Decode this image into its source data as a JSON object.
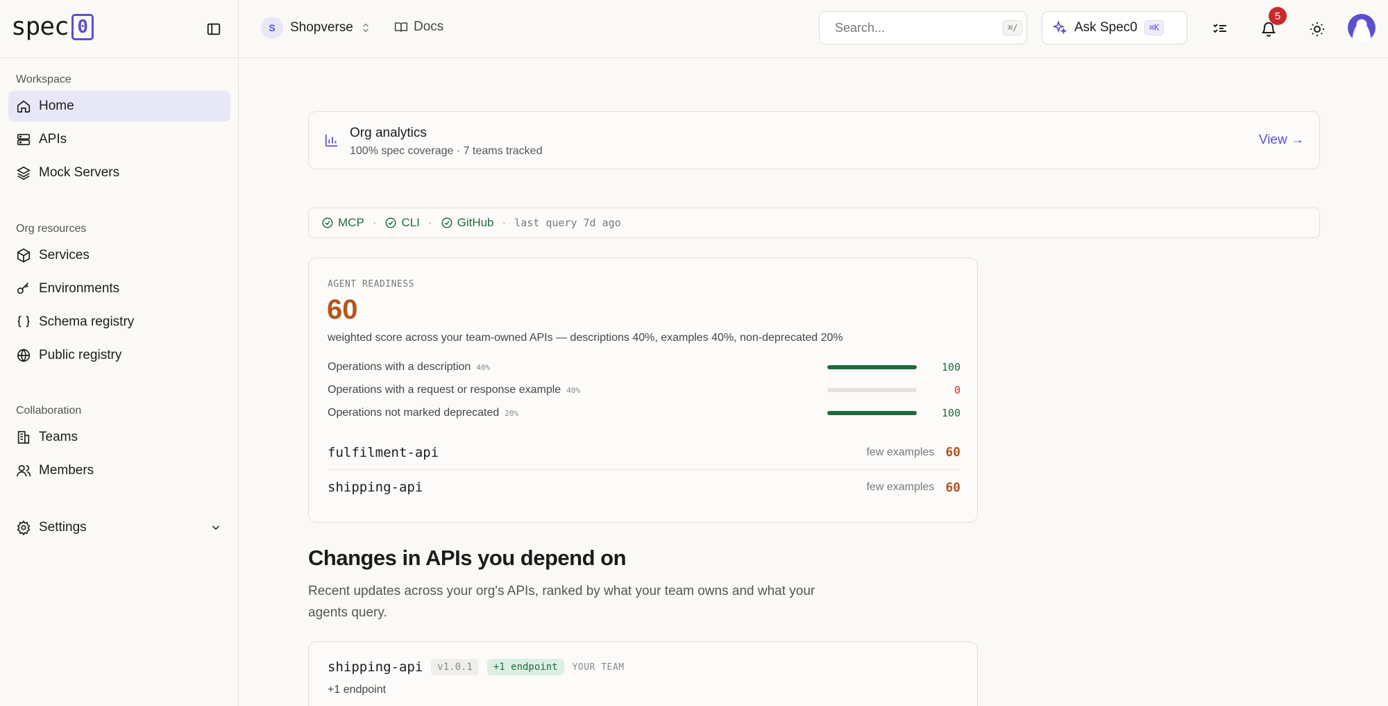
{
  "brand": {
    "text": "spec",
    "mark": "0"
  },
  "org": {
    "initial": "S",
    "name": "Shopverse"
  },
  "docs_label": "Docs",
  "search": {
    "placeholder": "Search...",
    "shortcut": "⌘/"
  },
  "ask": {
    "label": "Ask Spec0",
    "shortcut": "⌘K"
  },
  "notifications": {
    "count": "5"
  },
  "sidebar": {
    "workspace_heading": "Workspace",
    "workspace_items": [
      {
        "label": "Home",
        "icon": "home-icon",
        "active": true
      },
      {
        "label": "APIs",
        "icon": "server-icon"
      },
      {
        "label": "Mock Servers",
        "icon": "layers-icon"
      }
    ],
    "resources_heading": "Org resources",
    "resources_items": [
      {
        "label": "Services",
        "icon": "box-icon"
      },
      {
        "label": "Environments",
        "icon": "key-icon"
      },
      {
        "label": "Schema registry",
        "icon": "braces-icon"
      },
      {
        "label": "Public registry",
        "icon": "globe-icon"
      }
    ],
    "collab_heading": "Collaboration",
    "collab_items": [
      {
        "label": "Teams",
        "icon": "building-icon"
      },
      {
        "label": "Members",
        "icon": "users-icon"
      }
    ],
    "settings_label": "Settings"
  },
  "analytics": {
    "title": "Org analytics",
    "subtitle": "100% spec coverage · 7 teams tracked",
    "view_label": "View →"
  },
  "integrations": {
    "items": [
      "MCP",
      "CLI",
      "GitHub"
    ],
    "last_query": "last query 7d ago",
    "status_color": "#1f6b3d"
  },
  "readiness": {
    "eyebrow": "AGENT READINESS",
    "score": "60",
    "description": "weighted score across your team-owned APIs — descriptions 40%, examples 40%, non-deprecated 20%",
    "metrics": [
      {
        "label": "Operations with a description",
        "weight": "40%",
        "value": "100",
        "fill": 1.0
      },
      {
        "label": "Operations with a request or response example",
        "weight": "40%",
        "value": "0",
        "fill": 0.0
      },
      {
        "label": "Operations not marked deprecated",
        "weight": "20%",
        "value": "100",
        "fill": 1.0
      }
    ],
    "apis": [
      {
        "name": "fulfilment-api",
        "note": "few examples",
        "score": "60"
      },
      {
        "name": "shipping-api",
        "note": "few examples",
        "score": "60"
      }
    ]
  },
  "changes": {
    "title": "Changes in APIs you depend on",
    "description": "Recent updates across your org's APIs, ranked by what your team owns and what your agents query.",
    "items": [
      {
        "name": "shipping-api",
        "version": "v1.0.1",
        "delta": "+1 endpoint",
        "owner_tag": "YOUR TEAM",
        "summary": "+1 endpoint"
      }
    ]
  },
  "colors": {
    "accent": "#5b4fd1",
    "score": "#b5561b",
    "success": "#1f6b3d",
    "danger": "#c92a2a"
  }
}
